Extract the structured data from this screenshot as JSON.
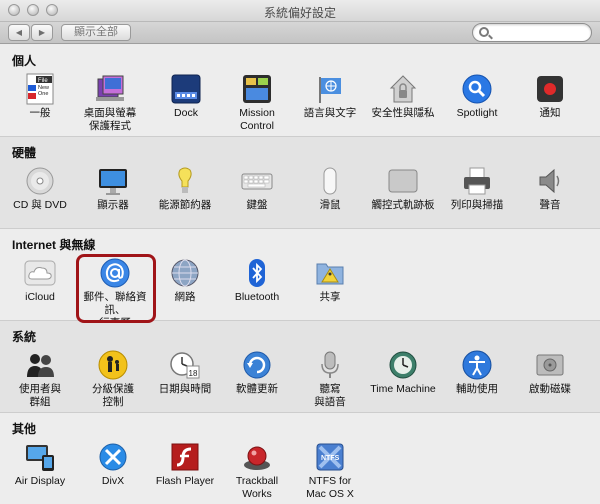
{
  "window": {
    "title": "系統偏好設定"
  },
  "toolbar": {
    "show_all": "顯示全部",
    "search_placeholder": ""
  },
  "sections": {
    "personal": {
      "title": "個人",
      "items": [
        {
          "label": "一般"
        },
        {
          "label": "桌面與螢幕\n保護程式"
        },
        {
          "label": "Dock"
        },
        {
          "label": "Mission\nControl"
        },
        {
          "label": "語言與文字"
        },
        {
          "label": "安全性與隱私"
        },
        {
          "label": "Spotlight"
        },
        {
          "label": "通知"
        }
      ]
    },
    "hardware": {
      "title": "硬體",
      "items": [
        {
          "label": "CD 與 DVD"
        },
        {
          "label": "顯示器"
        },
        {
          "label": "能源節約器"
        },
        {
          "label": "鍵盤"
        },
        {
          "label": "滑鼠"
        },
        {
          "label": "觸控式軌跡板"
        },
        {
          "label": "列印與掃描"
        },
        {
          "label": "聲音"
        }
      ]
    },
    "internet": {
      "title": "Internet 與無線",
      "items": [
        {
          "label": "iCloud"
        },
        {
          "label": "郵件、聯絡資訊、\n行事曆"
        },
        {
          "label": "網路"
        },
        {
          "label": "Bluetooth"
        },
        {
          "label": "共享"
        }
      ]
    },
    "system": {
      "title": "系統",
      "items": [
        {
          "label": "使用者與\n群組"
        },
        {
          "label": "分級保護\n控制"
        },
        {
          "label": "日期與時間"
        },
        {
          "label": "軟體更新"
        },
        {
          "label": "聽寫\n與語音"
        },
        {
          "label": "Time Machine"
        },
        {
          "label": "輔助使用"
        },
        {
          "label": "啟動磁碟"
        }
      ]
    },
    "other": {
      "title": "其他",
      "items": [
        {
          "label": "Air Display"
        },
        {
          "label": "DivX"
        },
        {
          "label": "Flash Player"
        },
        {
          "label": "Trackball\nWorks"
        },
        {
          "label": "NTFS for\nMac OS X"
        }
      ]
    }
  },
  "icon_texts": {
    "general_file": "File",
    "general_new": "New",
    "general_one": "One",
    "calendar_day": "18",
    "ntfs": "NTFS"
  },
  "colors": {
    "highlight": "#a01418",
    "accent_blue": "#2f6fd6"
  }
}
